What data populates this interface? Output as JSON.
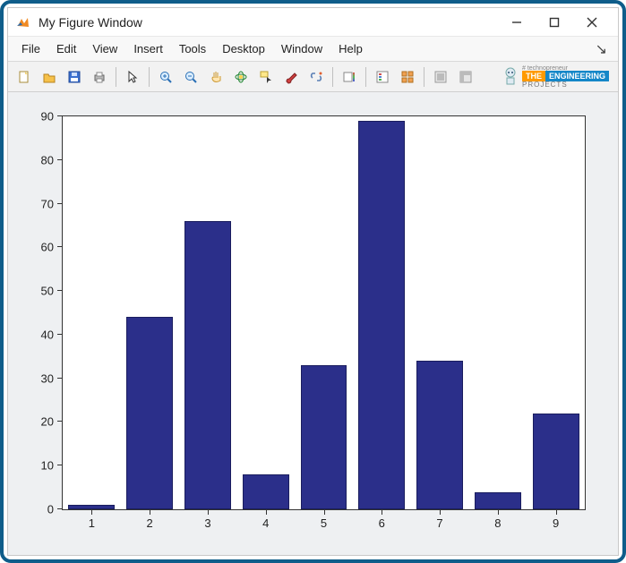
{
  "window": {
    "title": "My Figure Window"
  },
  "menu": {
    "items": [
      "File",
      "Edit",
      "View",
      "Insert",
      "Tools",
      "Desktop",
      "Window",
      "Help"
    ]
  },
  "toolbar": {
    "icons": [
      "new-file-icon",
      "open-file-icon",
      "save-icon",
      "print-icon",
      "sep",
      "pointer-icon",
      "sep",
      "zoom-in-icon",
      "zoom-out-icon",
      "pan-icon",
      "rotate-3d-icon",
      "data-cursor-icon",
      "brush-icon",
      "link-plots-icon",
      "sep",
      "insert-colorbar-icon",
      "sep",
      "insert-legend-icon",
      "subplots-icon",
      "sep",
      "hide-plot-tools-icon",
      "show-plot-tools-icon"
    ]
  },
  "brand": {
    "t1": "THE",
    "t2": "ENGINEERING",
    "sub": "PROJECTS",
    "tag": "# technopreneur"
  },
  "chart_data": {
    "type": "bar",
    "categories": [
      "1",
      "2",
      "3",
      "4",
      "5",
      "6",
      "7",
      "8",
      "9"
    ],
    "values": [
      1,
      44,
      66,
      8,
      33,
      89,
      34,
      4,
      22
    ],
    "ylim": [
      0,
      90
    ],
    "yticks": [
      0,
      10,
      20,
      30,
      40,
      50,
      60,
      70,
      80,
      90
    ],
    "title": "",
    "xlabel": "",
    "ylabel": ""
  }
}
